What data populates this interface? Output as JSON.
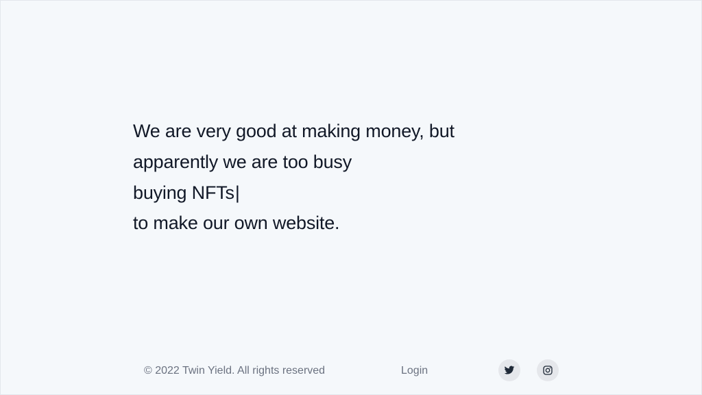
{
  "hero": {
    "lines": [
      "We are very good at making money, but",
      "apparently we are too busy",
      "buying NFTs",
      "to make our own website."
    ],
    "cursor": "|"
  },
  "footer": {
    "copyright": "© 2022 Twin Yield. All rights reserved",
    "login_label": "Login",
    "social": [
      {
        "icon": "twitter-icon"
      },
      {
        "icon": "instagram-icon"
      }
    ]
  },
  "colors": {
    "background": "#f5f8fb",
    "text": "#111827",
    "muted": "#6b7280",
    "icon_bg": "#e5e7eb"
  }
}
